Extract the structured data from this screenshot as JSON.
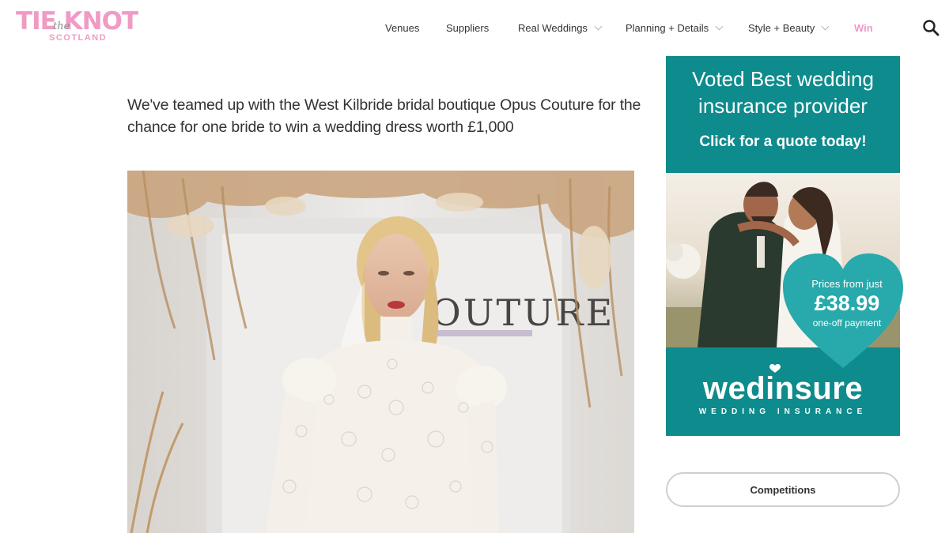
{
  "header": {
    "logo": {
      "main": "TIE KNOT",
      "the": "the",
      "sub": "SCOTLAND"
    },
    "nav": [
      {
        "label": "Venues",
        "dropdown": false
      },
      {
        "label": "Suppliers",
        "dropdown": false
      },
      {
        "label": "Real Weddings",
        "dropdown": true
      },
      {
        "label": "Planning + Details",
        "dropdown": true
      },
      {
        "label": "Style + Beauty",
        "dropdown": true
      },
      {
        "label": "Win",
        "dropdown": false
      }
    ],
    "search_icon": "search-icon"
  },
  "main": {
    "intro": "We've teamed up with the West Kilbride bridal boutique Opus Couture for the chance for one bride to win a wedding dress worth £1,000",
    "hero_sign": "OUTURE"
  },
  "sidebar": {
    "ad": {
      "headline_line1": "Voted Best wedding",
      "headline_line2": "insurance provider",
      "cta": "Click for a quote today!",
      "price_prefix": "Prices from just",
      "price": "£38.99",
      "price_suffix": "one-off payment",
      "brand": "wedinsure",
      "tagline": "WEDDING INSURANCE"
    },
    "competitions_button": "Competitions"
  },
  "colors": {
    "brand_pink": "#f19ac4",
    "ad_teal": "#0e8b8c",
    "heart_teal": "#28a9ab"
  }
}
